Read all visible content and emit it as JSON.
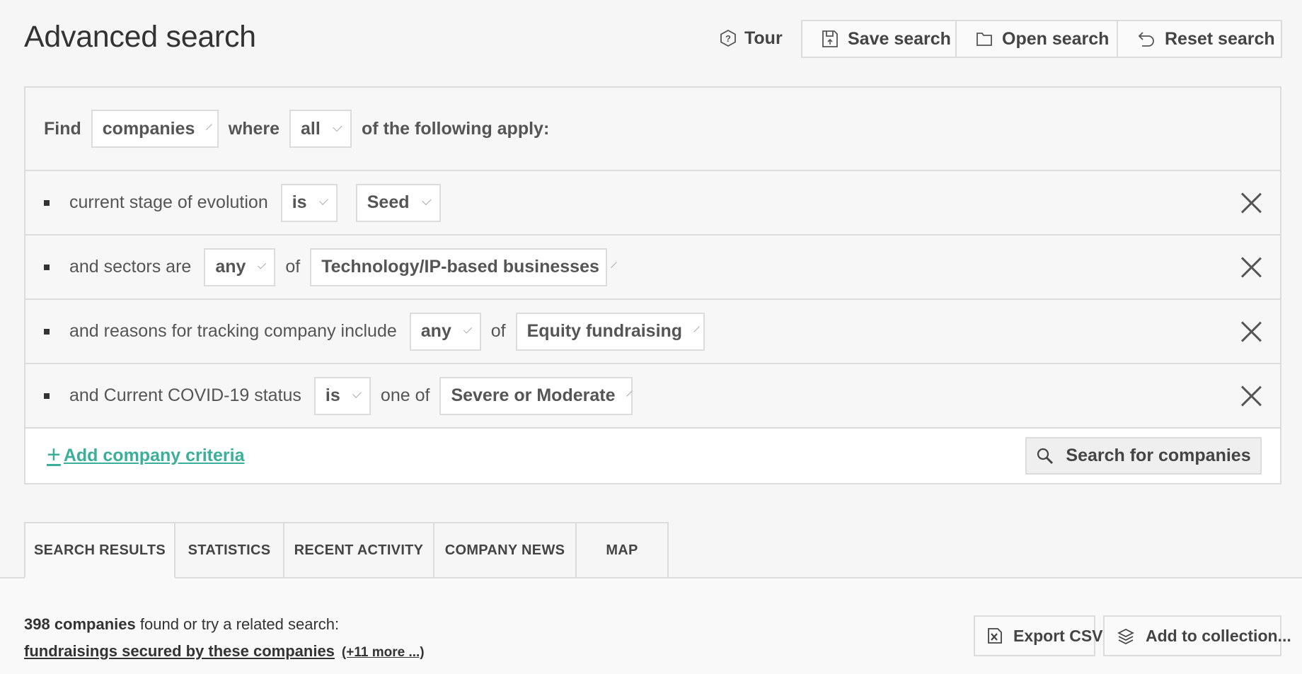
{
  "header": {
    "title": "Advanced search",
    "tour_label": "Tour",
    "save_label": "Save search",
    "open_label": "Open search",
    "reset_label": "Reset search"
  },
  "find_row": {
    "find_label": "Find",
    "entity": "companies",
    "where_label": "where",
    "quantifier": "all",
    "suffix": "of the following apply:"
  },
  "criteria": [
    {
      "label": "current stage of evolution",
      "operator": "is",
      "connector": "",
      "value": "Seed"
    },
    {
      "label": "and sectors are",
      "operator": "any",
      "connector": "of",
      "value": "Technology/IP-based businesses"
    },
    {
      "label": "and reasons for tracking company include",
      "operator": "any",
      "connector": "of",
      "value": "Equity fundraising"
    },
    {
      "label": "and Current COVID-19 status",
      "operator": "is",
      "connector": "one of",
      "value": "Severe or Moderate"
    }
  ],
  "actions": {
    "add_label": "Add company criteria",
    "search_label": "Search for companies"
  },
  "tabs": [
    "SEARCH RESULTS",
    "STATISTICS",
    "RECENT ACTIVITY",
    "COMPANY NEWS",
    "MAP"
  ],
  "results": {
    "count": "398 companies",
    "count_suffix": "found or try a related search:",
    "related_link": "fundraisings secured by these companies",
    "more_link": "(+11 more ...)",
    "export_label": "Export CSV",
    "collection_label": "Add to collection..."
  },
  "colors": {
    "accent": "#3aaf99",
    "border": "#dcdcdc",
    "background": "#f6f6f6"
  },
  "icons": {
    "tour": "tour-hexagon-icon",
    "save": "save-icon",
    "open": "folder-icon",
    "reset": "undo-icon",
    "remove": "close-icon",
    "add": "plus-icon",
    "search": "search-icon",
    "export": "export-csv-icon",
    "collection": "collection-icon"
  }
}
